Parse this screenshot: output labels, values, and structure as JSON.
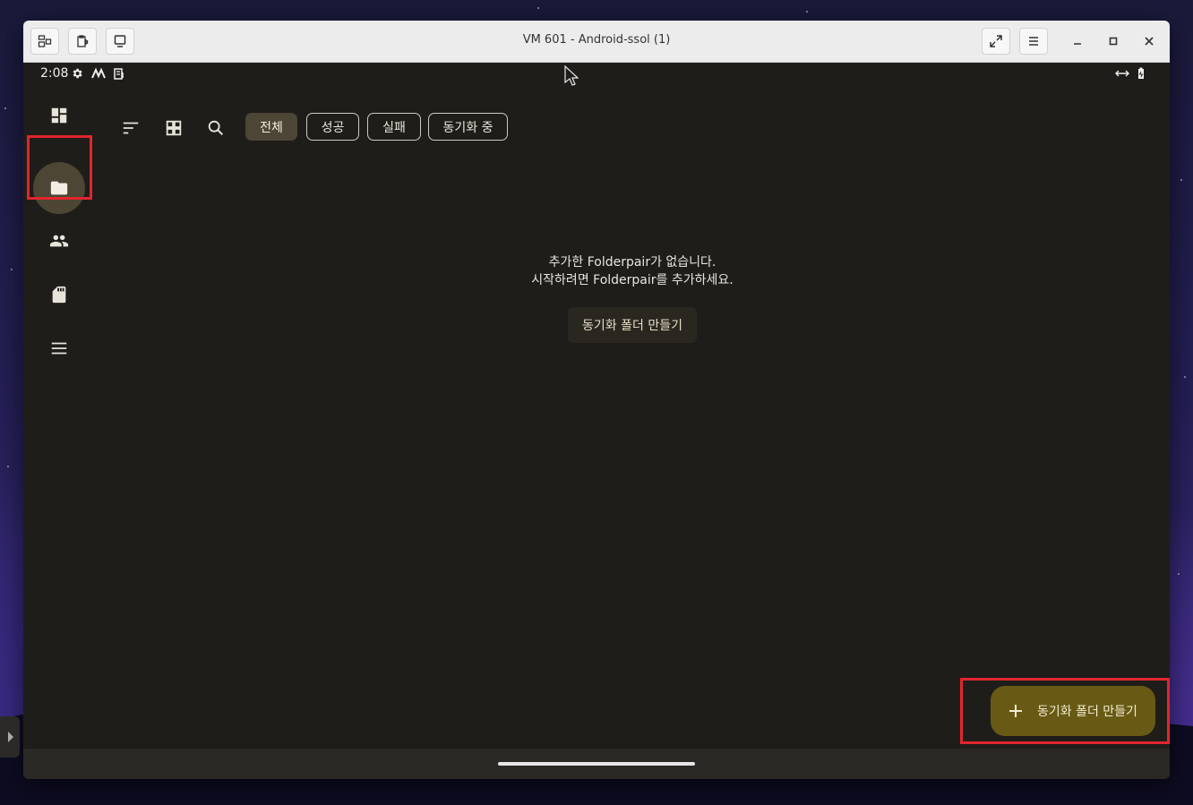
{
  "window": {
    "title": "VM 601 - Android-ssol (1)"
  },
  "statusbar": {
    "time": "2:08",
    "icons": [
      "gear-icon",
      "signal-m-icon",
      "clipboard-icon",
      "swap-arrows-icon",
      "battery-icon"
    ]
  },
  "navrail": {
    "items": [
      {
        "icon": "dashboard-icon"
      },
      {
        "icon": "folder-icon",
        "active": true
      },
      {
        "icon": "people-icon"
      },
      {
        "icon": "sd-card-icon"
      },
      {
        "icon": "menu-icon"
      }
    ]
  },
  "toolbar": {
    "icons": [
      "sort-icon",
      "grid-view-icon",
      "search-icon"
    ],
    "filters": [
      {
        "label": "전체",
        "selected": true
      },
      {
        "label": "성공",
        "selected": false
      },
      {
        "label": "실패",
        "selected": false
      },
      {
        "label": "동기화 중",
        "selected": false
      }
    ]
  },
  "empty": {
    "line1": "추가한 Folderpair가 없습니다.",
    "line2": "시작하려면 Folderpair를 추가하세요.",
    "create_label": "동기화 폴더 만들기"
  },
  "fab": {
    "label": "동기화 폴더 만들기"
  },
  "colors": {
    "highlight": "#e0262e",
    "fab_bg": "#685a14",
    "chip_selected": "#4d4636",
    "background": "#1f1d1a"
  }
}
